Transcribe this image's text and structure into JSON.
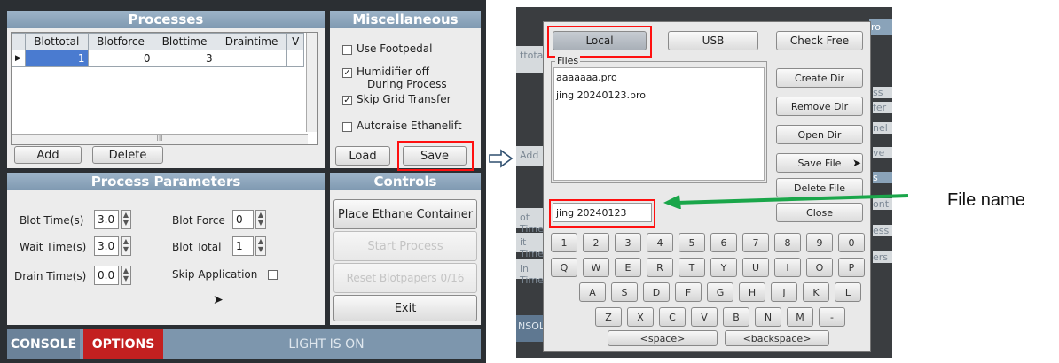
{
  "left": {
    "processes": {
      "title": "Processes",
      "columns": [
        "Blottotal",
        "Blotforce",
        "Blottime",
        "Draintime",
        "V"
      ],
      "row": [
        "1",
        "0",
        "3",
        ""
      ],
      "scroll_glyph": "III",
      "add_label": "Add",
      "delete_label": "Delete"
    },
    "misc": {
      "title": "Miscellaneous",
      "options": [
        {
          "label": "Use Footpedal",
          "checked": false
        },
        {
          "label": "Humidifier off",
          "label2": "During Process",
          "checked": true
        },
        {
          "label": "Skip Grid Transfer",
          "checked": true
        },
        {
          "label": "Autoraise Ethanelift",
          "checked": false
        }
      ],
      "load_label": "Load",
      "save_label": "Save"
    },
    "params": {
      "title": "Process Parameters",
      "blot_time_label": "Blot Time(s)",
      "blot_time_value": "3.0",
      "wait_time_label": "Wait Time(s)",
      "wait_time_value": "3.0",
      "drain_time_label": "Drain Time(s)",
      "drain_time_value": "0.0",
      "blot_force_label": "Blot Force",
      "blot_force_value": "0",
      "blot_total_label": "Blot Total",
      "blot_total_value": "1",
      "skip_label": "Skip Application"
    },
    "controls": {
      "title": "Controls",
      "place_label": "Place Ethane Container",
      "start_label": "Start Process",
      "reset_label": "Reset Blotpapers 0/16",
      "exit_label": "Exit"
    },
    "footer": {
      "console_label": "CONSOLE",
      "options_label": "OPTIONS",
      "status": "LIGHT IS ON"
    }
  },
  "right": {
    "local_label": "Local",
    "usb_label": "USB",
    "check_free_label": "Check Free",
    "files_label": "Files",
    "files": [
      "aaaaaaa.pro",
      "jing 20240123.pro"
    ],
    "create_dir_label": "Create Dir",
    "remove_dir_label": "Remove Dir",
    "open_dir_label": "Open Dir",
    "save_file_label": "Save File",
    "delete_file_label": "Delete File",
    "filename_value": "jing 20240123",
    "close_label": "Close",
    "keys_row1": [
      "1",
      "2",
      "3",
      "4",
      "5",
      "6",
      "7",
      "8",
      "9",
      "0"
    ],
    "keys_row2": [
      "Q",
      "W",
      "E",
      "R",
      "T",
      "Y",
      "U",
      "I",
      "O",
      "P"
    ],
    "keys_row3": [
      "A",
      "S",
      "D",
      "F",
      "G",
      "H",
      "J",
      "K",
      "L"
    ],
    "keys_row4": [
      "Z",
      "X",
      "C",
      "V",
      "B",
      "N",
      "M",
      "-"
    ],
    "space_label": "<space>",
    "backspace_label": "<backspace>",
    "bg_fragments": {
      "t1": "ttotal",
      "t2": "Add",
      "t3": "ot Time",
      "t4": "it Time(",
      "t5": "in Time",
      "t6": "NSOL",
      "r1": "ro",
      "r2": "ss",
      "r3": "fer",
      "r4": "nel",
      "r5": "ve",
      "r6": "s",
      "r7": "ont",
      "r8": "ess",
      "r9": "ers"
    }
  },
  "annotation": {
    "file_name_label": "File name",
    "arrow_color": "#1aa64a",
    "highlight_color": "#ff1010"
  }
}
